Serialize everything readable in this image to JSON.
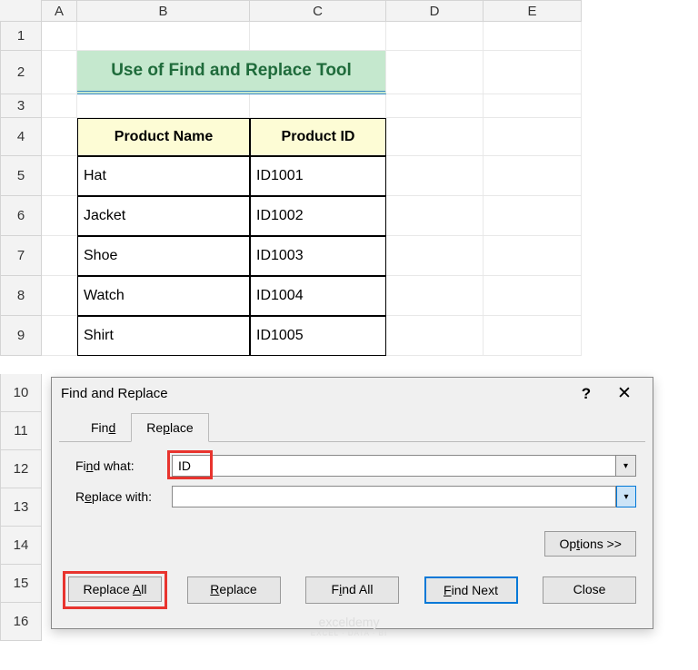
{
  "columns": [
    "A",
    "B",
    "C",
    "D",
    "E"
  ],
  "rows": [
    "1",
    "2",
    "3",
    "4",
    "5",
    "6",
    "7",
    "8",
    "9"
  ],
  "extra_rows": [
    "10",
    "11",
    "12",
    "13",
    "14",
    "15",
    "16"
  ],
  "title": "Use of Find and Replace Tool",
  "table": {
    "headers": [
      "Product Name",
      "Product ID"
    ],
    "data": [
      [
        "Hat",
        "ID1001"
      ],
      [
        "Jacket",
        "ID1002"
      ],
      [
        "Shoe",
        "ID1003"
      ],
      [
        "Watch",
        "ID1004"
      ],
      [
        "Shirt",
        "ID1005"
      ]
    ]
  },
  "dialog": {
    "title": "Find and Replace",
    "tabs": {
      "find": "Find",
      "find_underline": "d",
      "replace": "Replace",
      "replace_underline": ""
    },
    "find_what_label": "Find what:",
    "find_what_underline": "n",
    "find_what_value": "ID",
    "replace_with_label": "Replace with:",
    "replace_with_underline": "e",
    "replace_with_value": "",
    "options_label": "Options >>",
    "options_underline": "t",
    "buttons": {
      "replace_all": "Replace All",
      "replace_all_underline": "A",
      "replace": "Replace",
      "replace_underline": "R",
      "find_all": "Find All",
      "find_all_underline": "I",
      "find_next": "Find Next",
      "find_next_underline": "F",
      "close": "Close"
    }
  },
  "watermark": {
    "main": "exceldemy",
    "sub": "EXCEL · DATA · BI"
  }
}
